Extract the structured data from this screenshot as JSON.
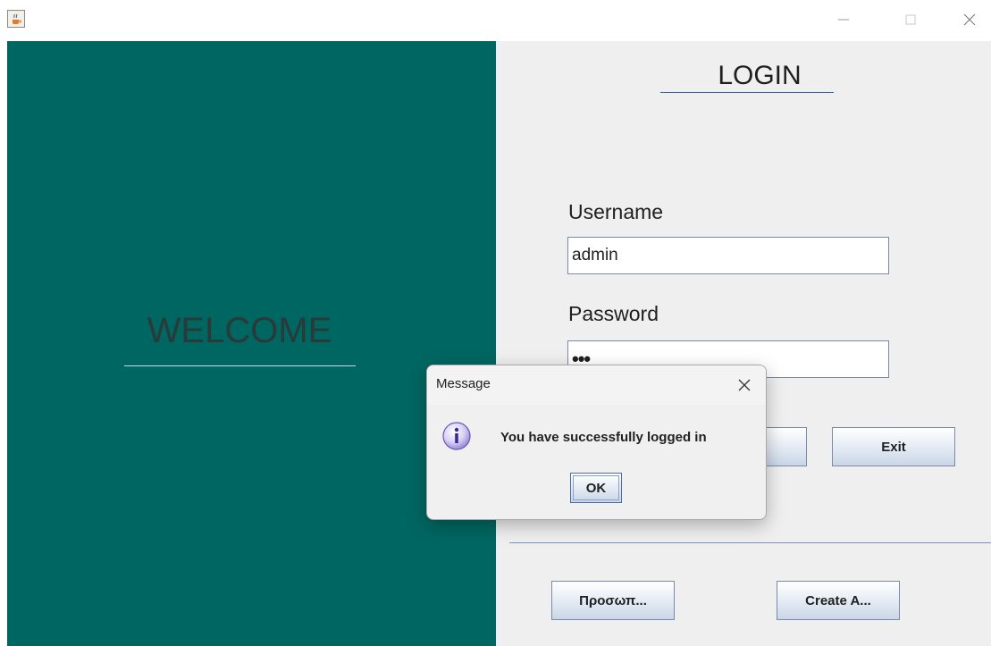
{
  "window": {
    "icons": {
      "app": "java-cup-icon",
      "minimize": "minimize-icon",
      "maximize": "maximize-icon",
      "close": "close-icon"
    }
  },
  "left_panel": {
    "welcome_text": "WELCOME",
    "color": "#006661"
  },
  "login_form": {
    "title": "LOGIN",
    "username_label": "Username",
    "username_value": "admin",
    "password_label": "Password",
    "password_value": "•••",
    "exit_label": "Exit",
    "profile_label": "Προσωπ...",
    "create_label": "Create A..."
  },
  "dialog": {
    "title": "Message",
    "message": "You have successfully logged in",
    "ok_label": "OK",
    "icon": "info-icon"
  }
}
